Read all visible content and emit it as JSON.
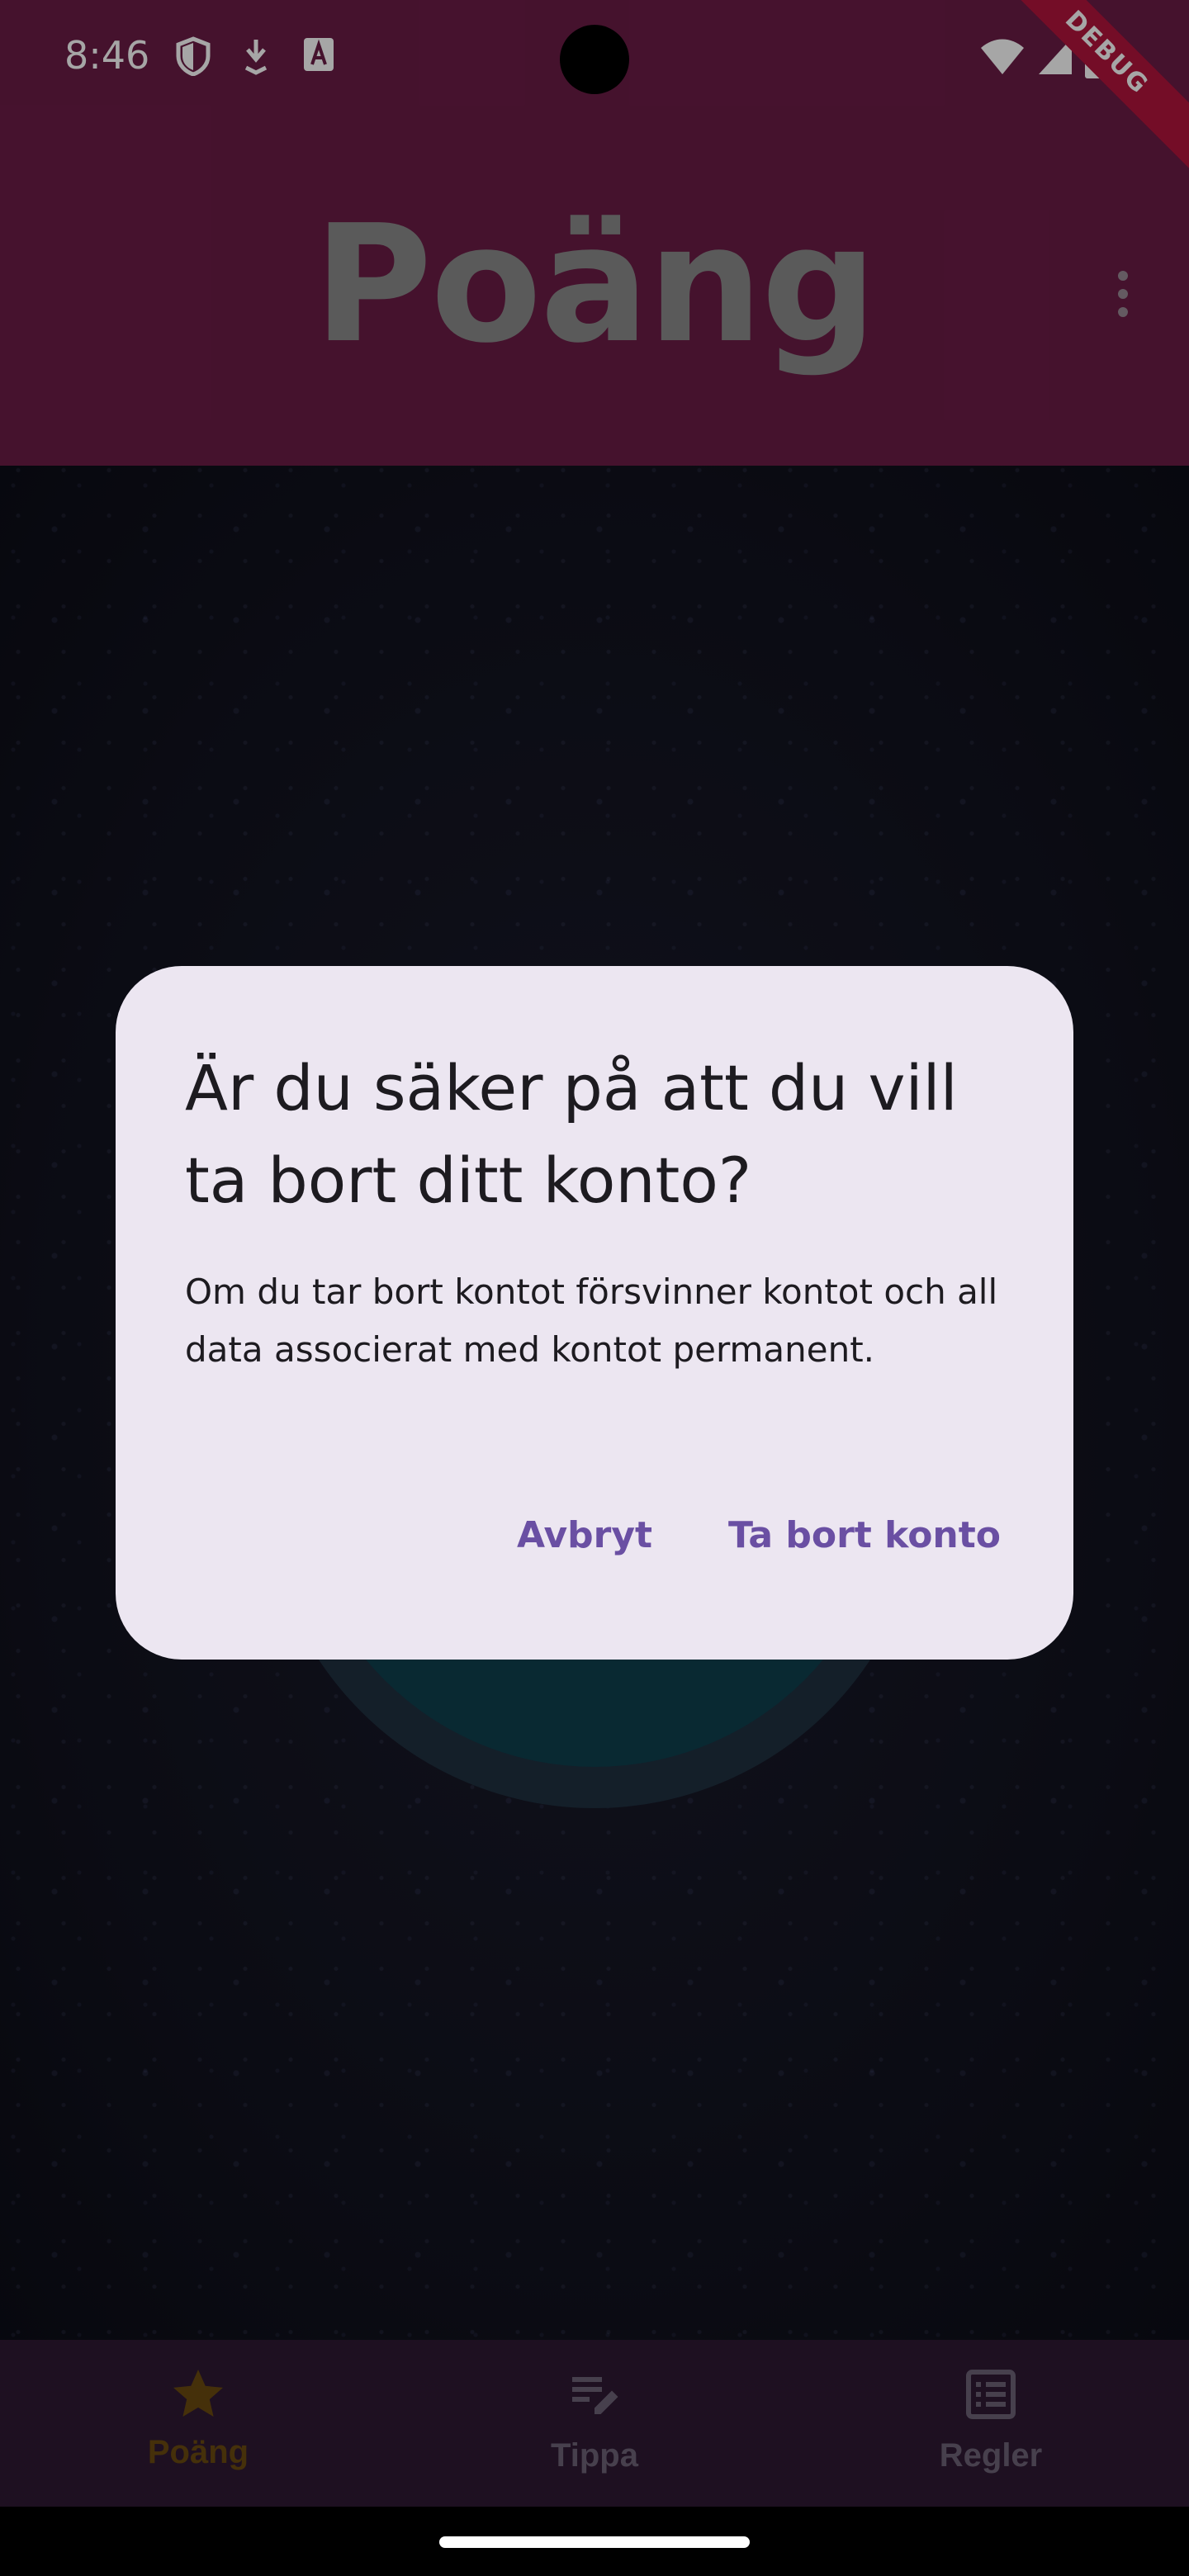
{
  "status_bar": {
    "time": "8:46",
    "debug_label": "DEBUG"
  },
  "app_bar": {
    "title": "Poäng"
  },
  "bottom_nav": {
    "items": [
      {
        "label": "Poäng",
        "icon": "star-icon",
        "active": true,
        "color": "#6b4a10"
      },
      {
        "label": "Tippa",
        "icon": "edit-list-icon",
        "active": false,
        "color": "#6e6377"
      },
      {
        "label": "Regler",
        "icon": "list-alt-icon",
        "active": false,
        "color": "#6e6377"
      }
    ]
  },
  "dialog": {
    "title": "Är du säker på att du vill ta bort ditt konto?",
    "body": "Om du tar bort kontot försvinner kontot och all data associerat med kontot permanent.",
    "cancel_label": "Avbryt",
    "confirm_label": "Ta bort konto"
  },
  "colors": {
    "app_bar": "#6b1c46",
    "dialog_bg": "#ece6f1",
    "dialog_action": "#6a4fa3",
    "bottom_nav_bg": "#2f1a34"
  }
}
